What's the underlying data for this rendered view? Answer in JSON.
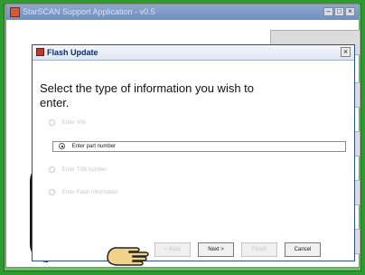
{
  "app": {
    "title": "StarSCAN Support Application - v0.5"
  },
  "dialog": {
    "title": "Flash Update",
    "prompt": "Select the type of information you wish to enter.",
    "options": [
      {
        "label": "Enter VIN",
        "selected": false
      },
      {
        "label": "Enter part number",
        "selected": true
      },
      {
        "label": "Enter TSB number",
        "selected": false
      },
      {
        "label": "Enter Flash information",
        "selected": false
      }
    ],
    "buttons": {
      "back": "< Back",
      "next": "Next >",
      "finish": "Finish",
      "cancel": "Cancel"
    }
  },
  "icons": {
    "app": "app-icon",
    "dialog": "dialog-icon",
    "close": "close-icon",
    "pointer": "hand-pointer-icon"
  },
  "colors": {
    "border_green": "#2f9a2f",
    "dialog_title": "#0b2c6a"
  }
}
